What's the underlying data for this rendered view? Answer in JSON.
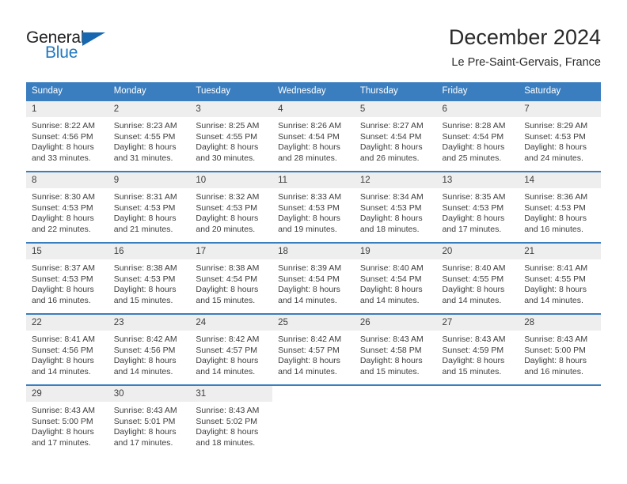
{
  "logo": {
    "word_primary": "General",
    "word_secondary": "Blue",
    "mark": "triangle-icon"
  },
  "header": {
    "title": "December 2024",
    "subtitle": "Le Pre-Saint-Gervais, France"
  },
  "calendar": {
    "weekday_headers": [
      "Sunday",
      "Monday",
      "Tuesday",
      "Wednesday",
      "Thursday",
      "Friday",
      "Saturday"
    ],
    "colors": {
      "header_background": "#3a7ebf",
      "header_text": "#ffffff",
      "day_number_band": "#eeeeee",
      "accent": "#1f78c1",
      "body_text": "#3d3d3d"
    },
    "weeks": [
      [
        {
          "day": "1",
          "sunrise": "Sunrise: 8:22 AM",
          "sunset": "Sunset: 4:56 PM",
          "daylight_line1": "Daylight: 8 hours",
          "daylight_line2": "and 33 minutes."
        },
        {
          "day": "2",
          "sunrise": "Sunrise: 8:23 AM",
          "sunset": "Sunset: 4:55 PM",
          "daylight_line1": "Daylight: 8 hours",
          "daylight_line2": "and 31 minutes."
        },
        {
          "day": "3",
          "sunrise": "Sunrise: 8:25 AM",
          "sunset": "Sunset: 4:55 PM",
          "daylight_line1": "Daylight: 8 hours",
          "daylight_line2": "and 30 minutes."
        },
        {
          "day": "4",
          "sunrise": "Sunrise: 8:26 AM",
          "sunset": "Sunset: 4:54 PM",
          "daylight_line1": "Daylight: 8 hours",
          "daylight_line2": "and 28 minutes."
        },
        {
          "day": "5",
          "sunrise": "Sunrise: 8:27 AM",
          "sunset": "Sunset: 4:54 PM",
          "daylight_line1": "Daylight: 8 hours",
          "daylight_line2": "and 26 minutes."
        },
        {
          "day": "6",
          "sunrise": "Sunrise: 8:28 AM",
          "sunset": "Sunset: 4:54 PM",
          "daylight_line1": "Daylight: 8 hours",
          "daylight_line2": "and 25 minutes."
        },
        {
          "day": "7",
          "sunrise": "Sunrise: 8:29 AM",
          "sunset": "Sunset: 4:53 PM",
          "daylight_line1": "Daylight: 8 hours",
          "daylight_line2": "and 24 minutes."
        }
      ],
      [
        {
          "day": "8",
          "sunrise": "Sunrise: 8:30 AM",
          "sunset": "Sunset: 4:53 PM",
          "daylight_line1": "Daylight: 8 hours",
          "daylight_line2": "and 22 minutes."
        },
        {
          "day": "9",
          "sunrise": "Sunrise: 8:31 AM",
          "sunset": "Sunset: 4:53 PM",
          "daylight_line1": "Daylight: 8 hours",
          "daylight_line2": "and 21 minutes."
        },
        {
          "day": "10",
          "sunrise": "Sunrise: 8:32 AM",
          "sunset": "Sunset: 4:53 PM",
          "daylight_line1": "Daylight: 8 hours",
          "daylight_line2": "and 20 minutes."
        },
        {
          "day": "11",
          "sunrise": "Sunrise: 8:33 AM",
          "sunset": "Sunset: 4:53 PM",
          "daylight_line1": "Daylight: 8 hours",
          "daylight_line2": "and 19 minutes."
        },
        {
          "day": "12",
          "sunrise": "Sunrise: 8:34 AM",
          "sunset": "Sunset: 4:53 PM",
          "daylight_line1": "Daylight: 8 hours",
          "daylight_line2": "and 18 minutes."
        },
        {
          "day": "13",
          "sunrise": "Sunrise: 8:35 AM",
          "sunset": "Sunset: 4:53 PM",
          "daylight_line1": "Daylight: 8 hours",
          "daylight_line2": "and 17 minutes."
        },
        {
          "day": "14",
          "sunrise": "Sunrise: 8:36 AM",
          "sunset": "Sunset: 4:53 PM",
          "daylight_line1": "Daylight: 8 hours",
          "daylight_line2": "and 16 minutes."
        }
      ],
      [
        {
          "day": "15",
          "sunrise": "Sunrise: 8:37 AM",
          "sunset": "Sunset: 4:53 PM",
          "daylight_line1": "Daylight: 8 hours",
          "daylight_line2": "and 16 minutes."
        },
        {
          "day": "16",
          "sunrise": "Sunrise: 8:38 AM",
          "sunset": "Sunset: 4:53 PM",
          "daylight_line1": "Daylight: 8 hours",
          "daylight_line2": "and 15 minutes."
        },
        {
          "day": "17",
          "sunrise": "Sunrise: 8:38 AM",
          "sunset": "Sunset: 4:54 PM",
          "daylight_line1": "Daylight: 8 hours",
          "daylight_line2": "and 15 minutes."
        },
        {
          "day": "18",
          "sunrise": "Sunrise: 8:39 AM",
          "sunset": "Sunset: 4:54 PM",
          "daylight_line1": "Daylight: 8 hours",
          "daylight_line2": "and 14 minutes."
        },
        {
          "day": "19",
          "sunrise": "Sunrise: 8:40 AM",
          "sunset": "Sunset: 4:54 PM",
          "daylight_line1": "Daylight: 8 hours",
          "daylight_line2": "and 14 minutes."
        },
        {
          "day": "20",
          "sunrise": "Sunrise: 8:40 AM",
          "sunset": "Sunset: 4:55 PM",
          "daylight_line1": "Daylight: 8 hours",
          "daylight_line2": "and 14 minutes."
        },
        {
          "day": "21",
          "sunrise": "Sunrise: 8:41 AM",
          "sunset": "Sunset: 4:55 PM",
          "daylight_line1": "Daylight: 8 hours",
          "daylight_line2": "and 14 minutes."
        }
      ],
      [
        {
          "day": "22",
          "sunrise": "Sunrise: 8:41 AM",
          "sunset": "Sunset: 4:56 PM",
          "daylight_line1": "Daylight: 8 hours",
          "daylight_line2": "and 14 minutes."
        },
        {
          "day": "23",
          "sunrise": "Sunrise: 8:42 AM",
          "sunset": "Sunset: 4:56 PM",
          "daylight_line1": "Daylight: 8 hours",
          "daylight_line2": "and 14 minutes."
        },
        {
          "day": "24",
          "sunrise": "Sunrise: 8:42 AM",
          "sunset": "Sunset: 4:57 PM",
          "daylight_line1": "Daylight: 8 hours",
          "daylight_line2": "and 14 minutes."
        },
        {
          "day": "25",
          "sunrise": "Sunrise: 8:42 AM",
          "sunset": "Sunset: 4:57 PM",
          "daylight_line1": "Daylight: 8 hours",
          "daylight_line2": "and 14 minutes."
        },
        {
          "day": "26",
          "sunrise": "Sunrise: 8:43 AM",
          "sunset": "Sunset: 4:58 PM",
          "daylight_line1": "Daylight: 8 hours",
          "daylight_line2": "and 15 minutes."
        },
        {
          "day": "27",
          "sunrise": "Sunrise: 8:43 AM",
          "sunset": "Sunset: 4:59 PM",
          "daylight_line1": "Daylight: 8 hours",
          "daylight_line2": "and 15 minutes."
        },
        {
          "day": "28",
          "sunrise": "Sunrise: 8:43 AM",
          "sunset": "Sunset: 5:00 PM",
          "daylight_line1": "Daylight: 8 hours",
          "daylight_line2": "and 16 minutes."
        }
      ],
      [
        {
          "day": "29",
          "sunrise": "Sunrise: 8:43 AM",
          "sunset": "Sunset: 5:00 PM",
          "daylight_line1": "Daylight: 8 hours",
          "daylight_line2": "and 17 minutes."
        },
        {
          "day": "30",
          "sunrise": "Sunrise: 8:43 AM",
          "sunset": "Sunset: 5:01 PM",
          "daylight_line1": "Daylight: 8 hours",
          "daylight_line2": "and 17 minutes."
        },
        {
          "day": "31",
          "sunrise": "Sunrise: 8:43 AM",
          "sunset": "Sunset: 5:02 PM",
          "daylight_line1": "Daylight: 8 hours",
          "daylight_line2": "and 18 minutes."
        },
        {
          "day": "",
          "sunrise": "",
          "sunset": "",
          "daylight_line1": "",
          "daylight_line2": ""
        },
        {
          "day": "",
          "sunrise": "",
          "sunset": "",
          "daylight_line1": "",
          "daylight_line2": ""
        },
        {
          "day": "",
          "sunrise": "",
          "sunset": "",
          "daylight_line1": "",
          "daylight_line2": ""
        },
        {
          "day": "",
          "sunrise": "",
          "sunset": "",
          "daylight_line1": "",
          "daylight_line2": ""
        }
      ]
    ]
  }
}
